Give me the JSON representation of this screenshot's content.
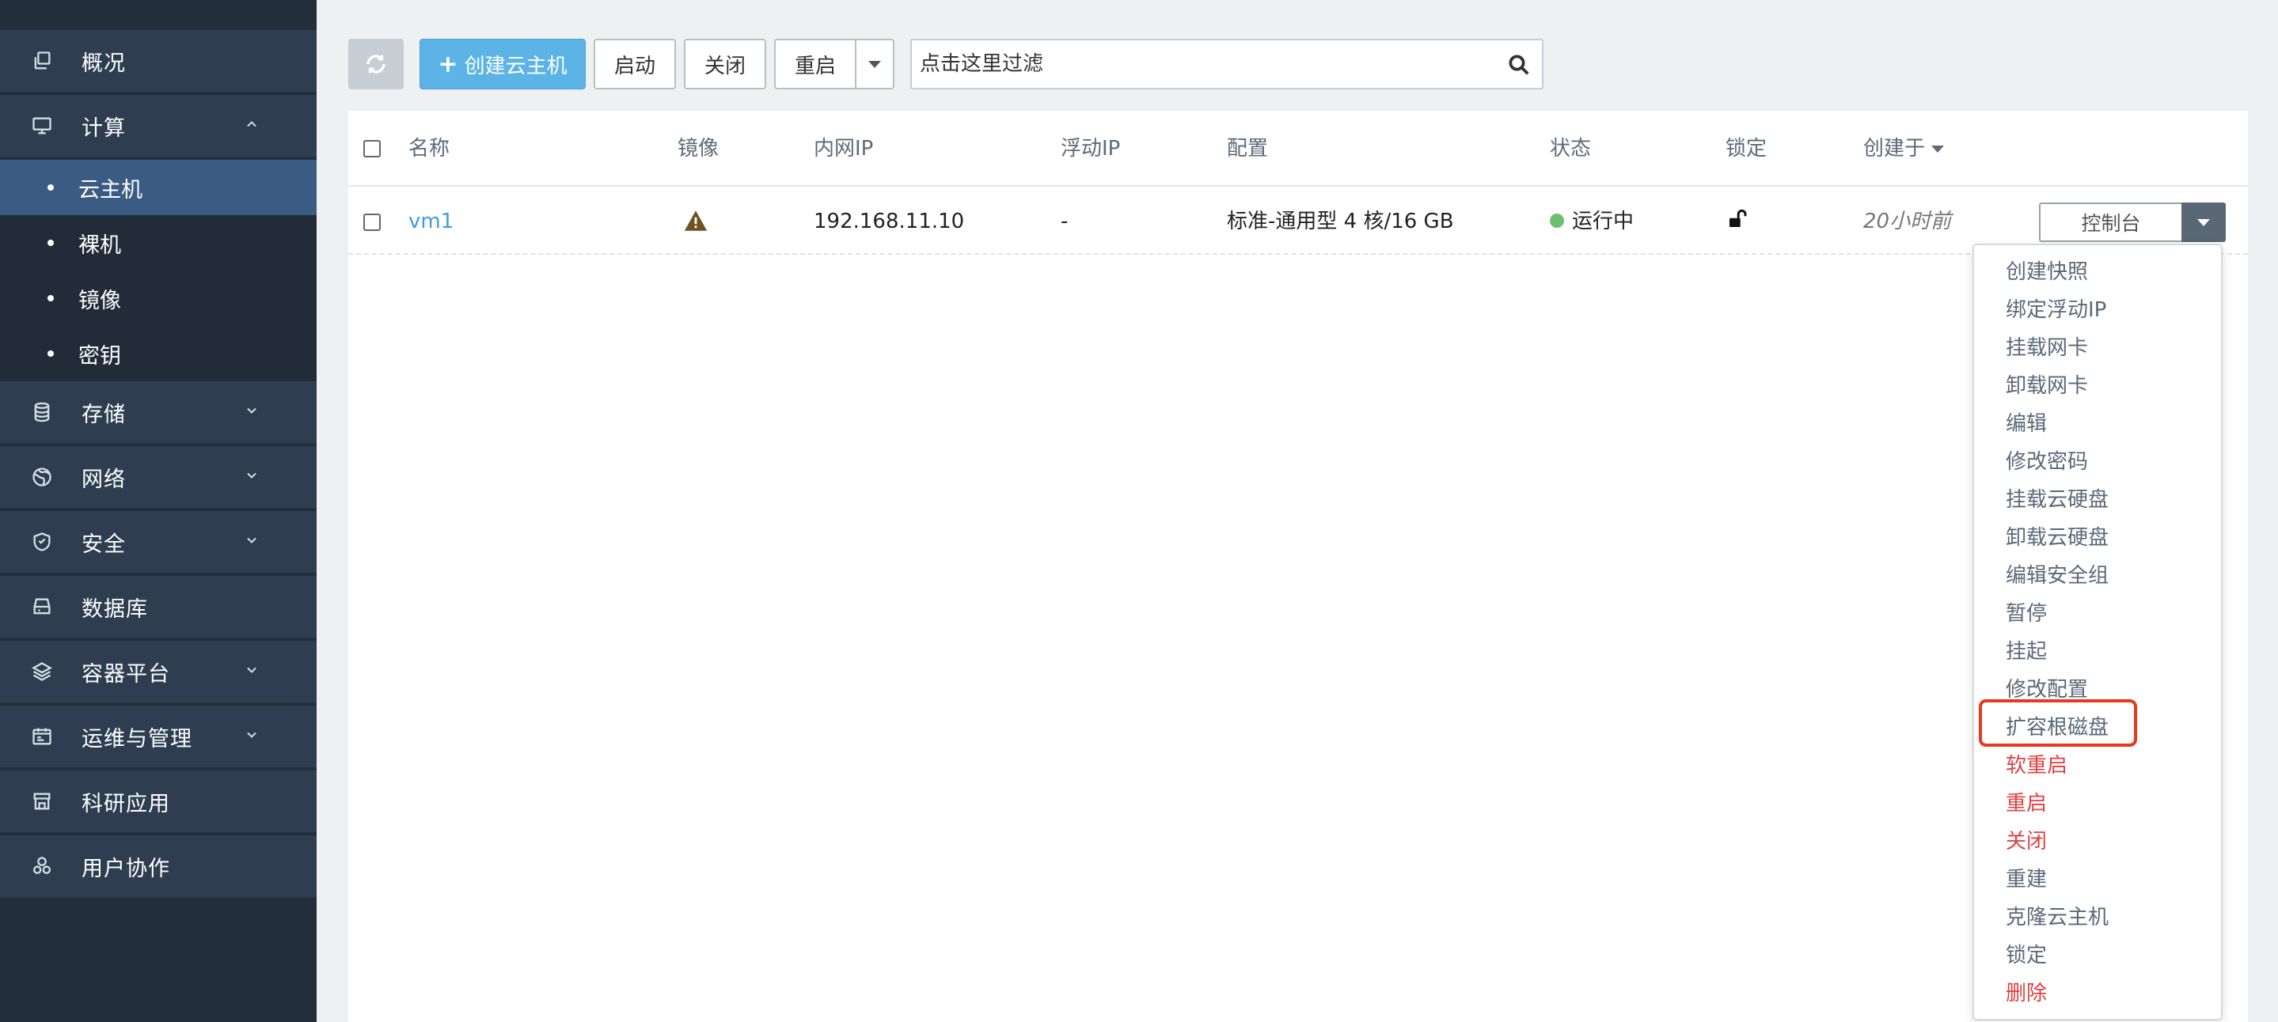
{
  "sidebar": {
    "items": [
      {
        "label": "概况",
        "icon": "copy-icon"
      },
      {
        "label": "计算",
        "icon": "monitor-icon",
        "expanded": true
      },
      {
        "label": "存储",
        "icon": "database-icon"
      },
      {
        "label": "网络",
        "icon": "globe-icon"
      },
      {
        "label": "安全",
        "icon": "shield-icon"
      },
      {
        "label": "数据库",
        "icon": "db-server-icon"
      },
      {
        "label": "容器平台",
        "icon": "cube-icon"
      },
      {
        "label": "运维与管理",
        "icon": "calendar-icon"
      },
      {
        "label": "科研应用",
        "icon": "store-icon"
      },
      {
        "label": "用户协作",
        "icon": "users-icon"
      }
    ],
    "compute_subitems": [
      {
        "label": "云主机",
        "active": true
      },
      {
        "label": "裸机"
      },
      {
        "label": "镜像"
      },
      {
        "label": "密钥"
      }
    ]
  },
  "toolbar": {
    "create_label": "创建云主机",
    "start_label": "启动",
    "stop_label": "关闭",
    "reboot_label": "重启",
    "filter_placeholder": "点击这里过滤"
  },
  "table": {
    "columns": [
      "名称",
      "镜像",
      "内网IP",
      "浮动IP",
      "配置",
      "状态",
      "锁定",
      "创建于"
    ],
    "rows": [
      {
        "name": "vm1",
        "image": "warning-icon",
        "private_ip": "192.168.11.10",
        "floating_ip": "-",
        "flavor": "标准-通用型 4 核/16 GB",
        "status": "运行中",
        "locked": "unlock-icon",
        "created": "20小时前",
        "action_label": "控制台"
      }
    ]
  },
  "action_menu": {
    "items": [
      {
        "label": "创建快照"
      },
      {
        "label": "绑定浮动IP"
      },
      {
        "label": "挂载网卡"
      },
      {
        "label": "卸载网卡"
      },
      {
        "label": "编辑"
      },
      {
        "label": "修改密码"
      },
      {
        "label": "挂载云硬盘"
      },
      {
        "label": "卸载云硬盘"
      },
      {
        "label": "编辑安全组"
      },
      {
        "label": "暂停"
      },
      {
        "label": "挂起"
      },
      {
        "label": "修改配置"
      },
      {
        "label": "扩容根磁盘",
        "highlighted": true
      },
      {
        "label": "软重启",
        "danger": true
      },
      {
        "label": "重启",
        "danger": true
      },
      {
        "label": "关闭",
        "danger": true
      },
      {
        "label": "重建"
      },
      {
        "label": "克隆云主机"
      },
      {
        "label": "锁定"
      },
      {
        "label": "删除",
        "danger": true
      }
    ]
  },
  "colors": {
    "sidebar_bg": "#232e3b",
    "sidebar_item_bg": "#2e3e50",
    "active_subitem": "#3a5b82",
    "primary_button": "#5bb3e6",
    "link": "#3e9ed9",
    "status_running": "#6cc070",
    "danger": "#e04040",
    "highlight_box": "#e8391e"
  }
}
